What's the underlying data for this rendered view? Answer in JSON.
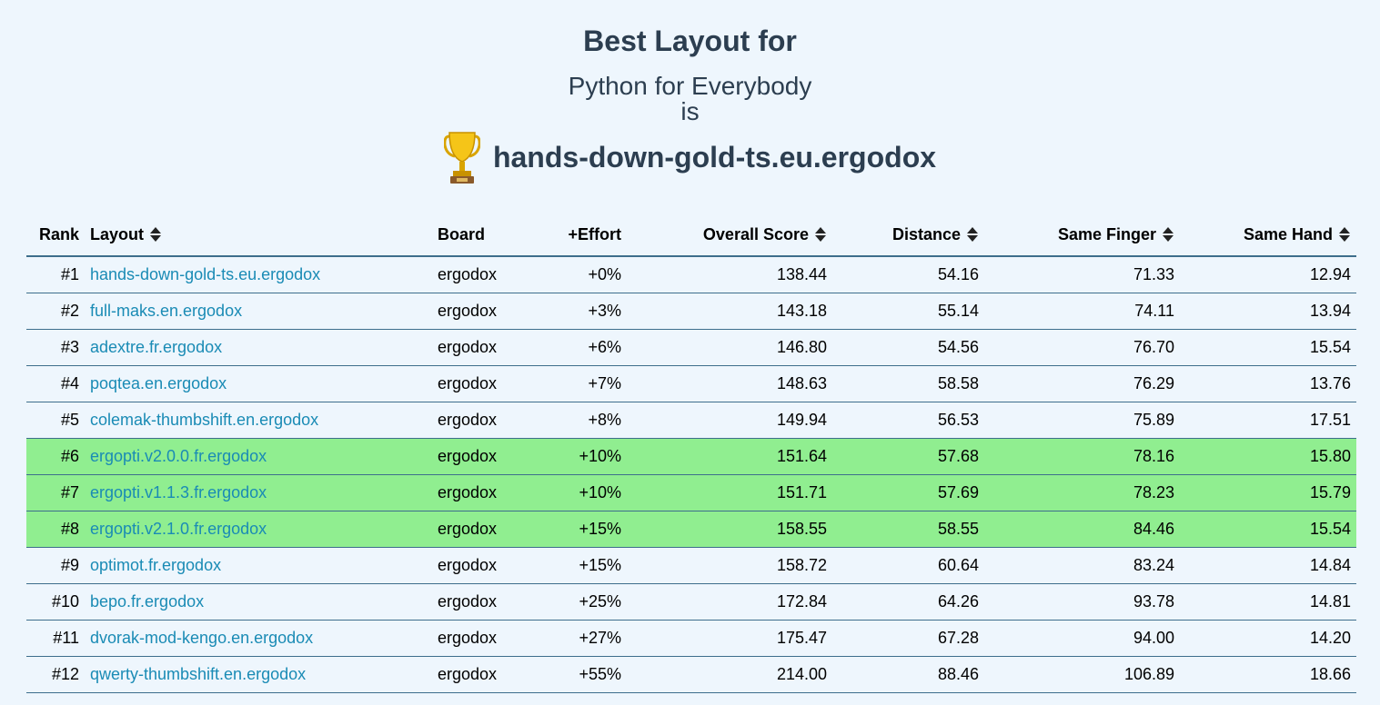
{
  "header": {
    "title": "Best Layout for",
    "subtitle": "Python for Everybody",
    "connector": "is",
    "winner": "hands-down-gold-ts.eu.ergodox",
    "winner_icon": "trophy-icon"
  },
  "table": {
    "columns": {
      "rank": "Rank",
      "layout": "Layout",
      "board": "Board",
      "effort": "+Effort",
      "overall": "Overall Score",
      "distance": "Distance",
      "same_finger": "Same Finger",
      "same_hand": "Same Hand"
    },
    "highlight_color": "#90ee90",
    "link_color": "#1a8bb5",
    "rows": [
      {
        "rank": "#1",
        "layout": "hands-down-gold-ts.eu.ergodox",
        "board": "ergodox",
        "effort": "+0%",
        "overall": "138.44",
        "distance": "54.16",
        "same_finger": "71.33",
        "same_hand": "12.94",
        "highlight": false
      },
      {
        "rank": "#2",
        "layout": "full-maks.en.ergodox",
        "board": "ergodox",
        "effort": "+3%",
        "overall": "143.18",
        "distance": "55.14",
        "same_finger": "74.11",
        "same_hand": "13.94",
        "highlight": false
      },
      {
        "rank": "#3",
        "layout": "adextre.fr.ergodox",
        "board": "ergodox",
        "effort": "+6%",
        "overall": "146.80",
        "distance": "54.56",
        "same_finger": "76.70",
        "same_hand": "15.54",
        "highlight": false
      },
      {
        "rank": "#4",
        "layout": "poqtea.en.ergodox",
        "board": "ergodox",
        "effort": "+7%",
        "overall": "148.63",
        "distance": "58.58",
        "same_finger": "76.29",
        "same_hand": "13.76",
        "highlight": false
      },
      {
        "rank": "#5",
        "layout": "colemak-thumbshift.en.ergodox",
        "board": "ergodox",
        "effort": "+8%",
        "overall": "149.94",
        "distance": "56.53",
        "same_finger": "75.89",
        "same_hand": "17.51",
        "highlight": false
      },
      {
        "rank": "#6",
        "layout": "ergopti.v2.0.0.fr.ergodox",
        "board": "ergodox",
        "effort": "+10%",
        "overall": "151.64",
        "distance": "57.68",
        "same_finger": "78.16",
        "same_hand": "15.80",
        "highlight": true
      },
      {
        "rank": "#7",
        "layout": "ergopti.v1.1.3.fr.ergodox",
        "board": "ergodox",
        "effort": "+10%",
        "overall": "151.71",
        "distance": "57.69",
        "same_finger": "78.23",
        "same_hand": "15.79",
        "highlight": true
      },
      {
        "rank": "#8",
        "layout": "ergopti.v2.1.0.fr.ergodox",
        "board": "ergodox",
        "effort": "+15%",
        "overall": "158.55",
        "distance": "58.55",
        "same_finger": "84.46",
        "same_hand": "15.54",
        "highlight": true
      },
      {
        "rank": "#9",
        "layout": "optimot.fr.ergodox",
        "board": "ergodox",
        "effort": "+15%",
        "overall": "158.72",
        "distance": "60.64",
        "same_finger": "83.24",
        "same_hand": "14.84",
        "highlight": false
      },
      {
        "rank": "#10",
        "layout": "bepo.fr.ergodox",
        "board": "ergodox",
        "effort": "+25%",
        "overall": "172.84",
        "distance": "64.26",
        "same_finger": "93.78",
        "same_hand": "14.81",
        "highlight": false
      },
      {
        "rank": "#11",
        "layout": "dvorak-mod-kengo.en.ergodox",
        "board": "ergodox",
        "effort": "+27%",
        "overall": "175.47",
        "distance": "67.28",
        "same_finger": "94.00",
        "same_hand": "14.20",
        "highlight": false
      },
      {
        "rank": "#12",
        "layout": "qwerty-thumbshift.en.ergodox",
        "board": "ergodox",
        "effort": "+55%",
        "overall": "214.00",
        "distance": "88.46",
        "same_finger": "106.89",
        "same_hand": "18.66",
        "highlight": false
      }
    ]
  }
}
